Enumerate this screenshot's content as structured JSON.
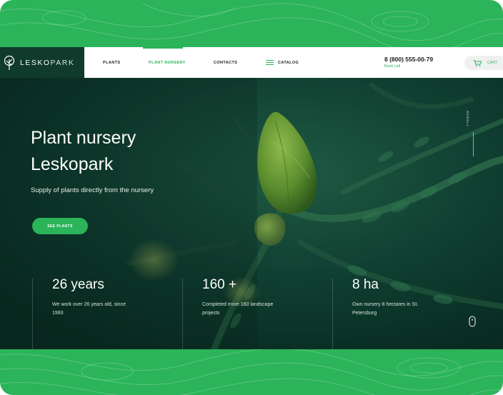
{
  "header": {
    "logo": {
      "brand": "LESKO",
      "brand_suffix": "PARK"
    },
    "nav": [
      {
        "label": "PLANTS",
        "active": false
      },
      {
        "label": "PLANT NURSERY",
        "active": true
      },
      {
        "label": "CONTACTS",
        "active": false
      },
      {
        "label": "CATALOG",
        "active": false
      }
    ],
    "phone": "8 (800) 555-00-79",
    "callback": "Back call",
    "cart_label": "CART"
  },
  "hero": {
    "title_line1": "Plant nursery",
    "title_line2": "Leskopark",
    "subtitle": "Supply of plants directly from the nursery",
    "cta_label": "SEE PLANTS",
    "scroll_label": "SCROLL",
    "stats": [
      {
        "value": "26 years",
        "desc": "We work over 26 years old, since 1993"
      },
      {
        "value": "160 +",
        "desc": "Completed more 160 landscape projects"
      },
      {
        "value": "8 ha",
        "desc": "Own nursery 8 hectares in St. Petersburg"
      }
    ]
  },
  "colors": {
    "accent": "#2bb45a",
    "logo_bg": "#0f3a2c",
    "hero_bg": "#0d3b2e"
  },
  "icons": [
    "tree-logo-icon",
    "catalog-menu-icon",
    "cart-icon",
    "mouse-scroll-icon"
  ]
}
